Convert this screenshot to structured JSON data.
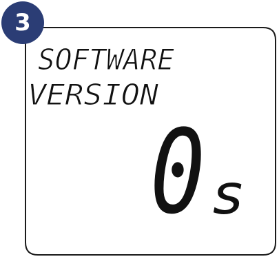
{
  "step": {
    "number": "3"
  },
  "display": {
    "title_line1": "SOFTWARE",
    "title_line2": "VERSION",
    "value": "0",
    "value_suffix": "s"
  },
  "colors": {
    "badge": "#2b3d75",
    "frame": "#1a1a1a",
    "segments": "#111111"
  }
}
